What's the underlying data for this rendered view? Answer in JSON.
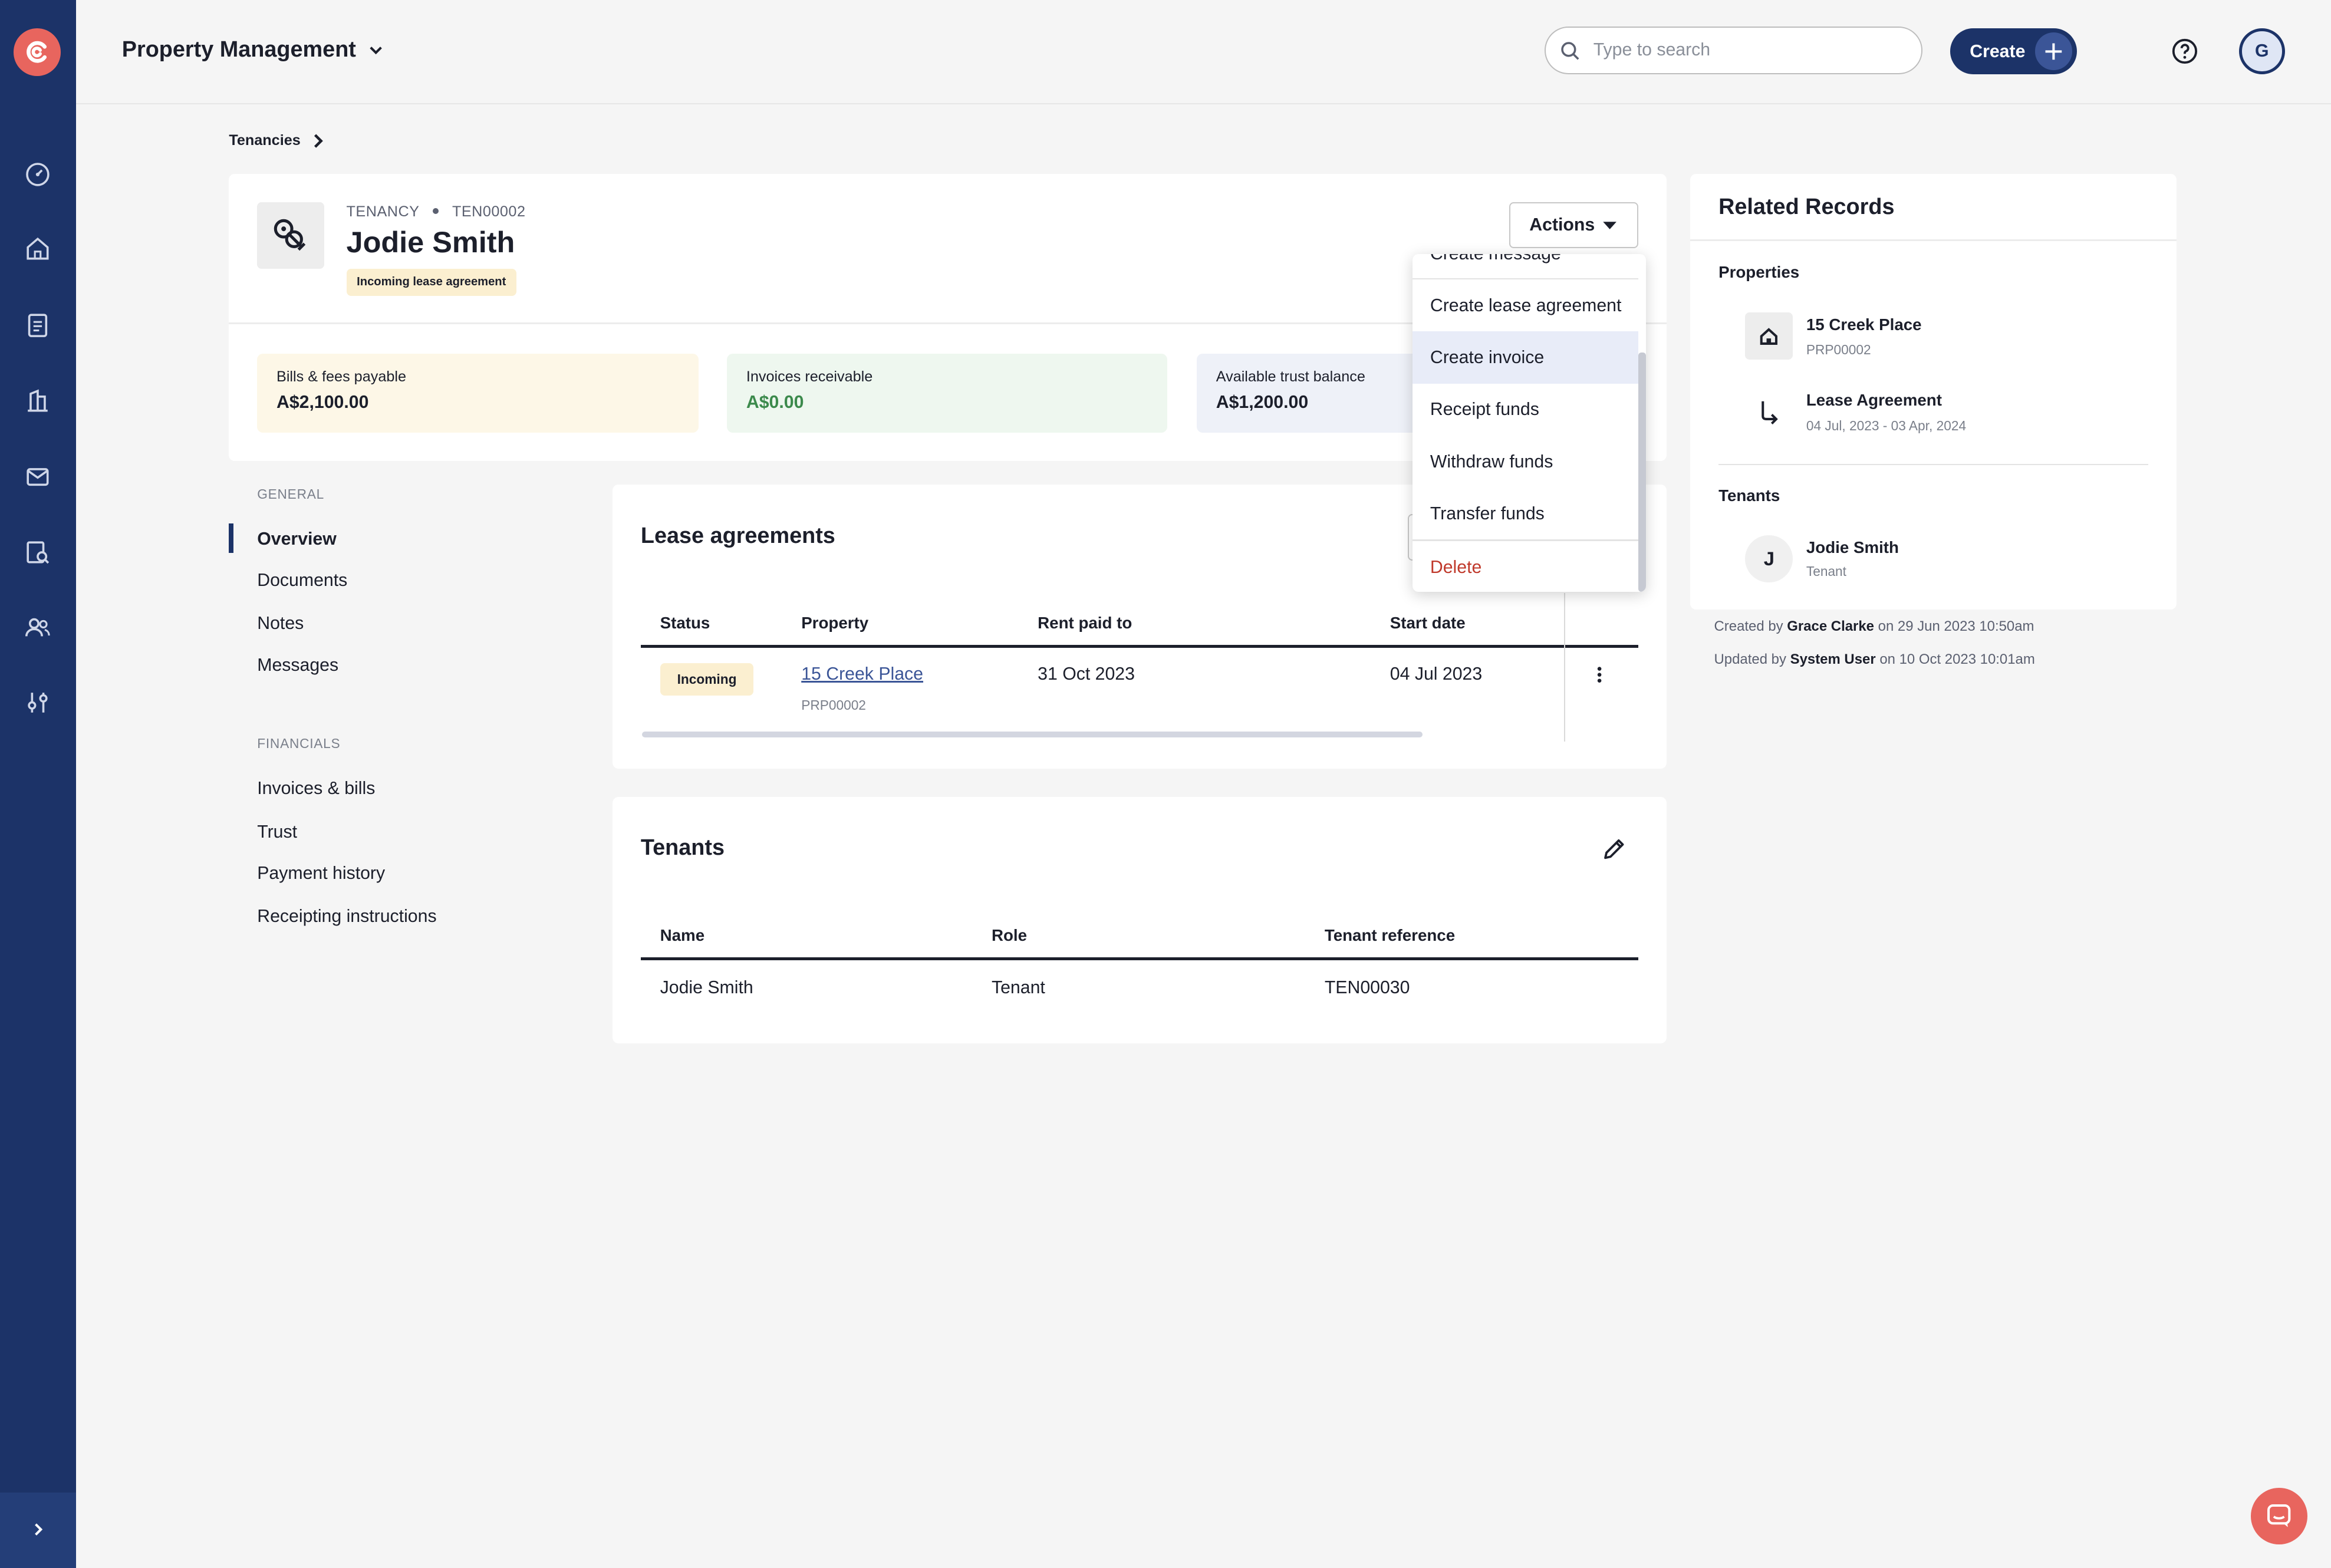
{
  "app": {
    "title": "Property Management",
    "avatar_initial": "G"
  },
  "search": {
    "placeholder": "Type to search",
    "value": ""
  },
  "topbar": {
    "create_label": "Create"
  },
  "breadcrumb": {
    "items": [
      "Tenancies"
    ]
  },
  "tenancy": {
    "type_label": "TENANCY",
    "reference": "TEN00002",
    "name": "Jodie Smith",
    "status_badge": "Incoming lease agreement",
    "actions_label": "Actions"
  },
  "financials": [
    {
      "label": "Bills & fees payable",
      "value": "A$2,100.00"
    },
    {
      "label": "Invoices receivable",
      "value": "A$0.00"
    },
    {
      "label": "Available trust balance",
      "value": "A$1,200.00"
    }
  ],
  "side_nav": {
    "general_label": "GENERAL",
    "general": [
      "Overview",
      "Documents",
      "Notes",
      "Messages"
    ],
    "financials_label": "FINANCIALS",
    "financials": [
      "Invoices & bills",
      "Trust",
      "Payment history",
      "Receipting instructions"
    ],
    "active": "Overview"
  },
  "lease_agreements": {
    "title": "Lease agreements",
    "columns": [
      "Status",
      "Property",
      "Rent paid to",
      "Start date"
    ],
    "rows": [
      {
        "status": "Incoming",
        "property": "15 Creek Place",
        "property_ref": "PRP00002",
        "rent_paid_to": "31 Oct 2023",
        "start_date": "04 Jul 2023"
      }
    ]
  },
  "tenants": {
    "title": "Tenants",
    "columns": [
      "Name",
      "Role",
      "Tenant reference"
    ],
    "rows": [
      {
        "name": "Jodie Smith",
        "role": "Tenant",
        "reference": "TEN00030"
      }
    ]
  },
  "actions_menu": {
    "items": [
      "Create message",
      "Create lease agreement",
      "Create invoice",
      "Receipt funds",
      "Withdraw funds",
      "Transfer funds",
      "Delete"
    ],
    "highlighted": "Create invoice"
  },
  "related_records": {
    "title": "Related Records",
    "properties_label": "Properties",
    "property": {
      "name": "15 Creek Place",
      "ref": "PRP00002"
    },
    "lease": {
      "name": "Lease Agreement",
      "dates": "04 Jul, 2023 - 03 Apr, 2024"
    },
    "tenants_label": "Tenants",
    "tenant": {
      "initial": "J",
      "name": "Jodie Smith",
      "role": "Tenant"
    }
  },
  "audit": {
    "created_prefix": "Created by",
    "created_by": "Grace Clarke",
    "created_on": "on 29 Jun 2023 10:50am",
    "updated_prefix": "Updated by",
    "updated_by": "System User",
    "updated_on": "on 10 Oct 2023 10:01am"
  },
  "colors": {
    "primary": "#1c3368",
    "accent": "#e8655e",
    "badge": "#fbefd0",
    "success": "#3c8a4c",
    "danger": "#c0392b"
  }
}
